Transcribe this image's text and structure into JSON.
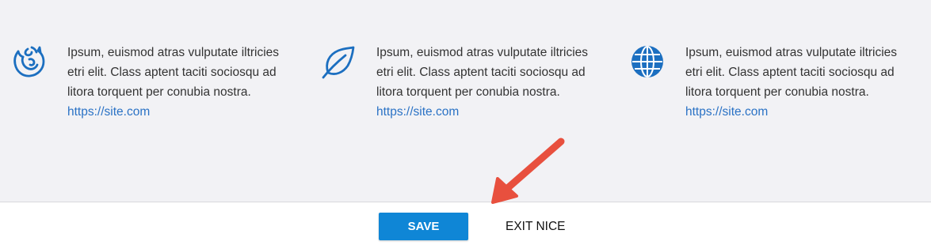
{
  "colors": {
    "background": "#f2f2f5",
    "icon_blue": "#1c6fc0",
    "link_blue": "#2a72c5",
    "save_button": "#0f86d6",
    "annotation_arrow": "#e8503e"
  },
  "features": [
    {
      "icon": "firefox-icon",
      "line1": "Ipsum, euismod atras vulputate iltricies",
      "line2": "etri elit. Class aptent taciti sociosqu ad",
      "line3": "litora torquent per conubia nostra.",
      "link": "https://site.com"
    },
    {
      "icon": "leaf-icon",
      "line1": "Ipsum, euismod atras vulputate iltricies",
      "line2": "etri elit. Class aptent taciti sociosqu ad",
      "line3": "litora torquent per conubia nostra.",
      "link": "https://site.com"
    },
    {
      "icon": "globe-icon",
      "line1": "Ipsum, euismod atras vulputate iltricies",
      "line2": "etri elit. Class aptent taciti sociosqu ad",
      "line3": "litora torquent per conubia nostra.",
      "link": "https://site.com"
    }
  ],
  "footer": {
    "save_label": "SAVE",
    "exit_label": "EXIT NICE"
  },
  "annotation": {
    "icon": "red-arrow-icon"
  }
}
